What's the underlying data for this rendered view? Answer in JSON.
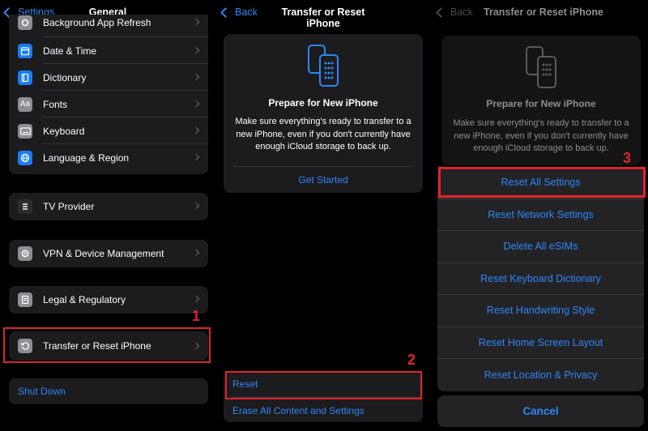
{
  "panel1": {
    "back_label": "Settings",
    "title": "General",
    "group1": [
      {
        "label": "Background App Refresh",
        "icon": "gear-icon",
        "color": "#8e8e93"
      },
      {
        "label": "Date & Time",
        "icon": "calendar-icon",
        "color": "#1a7cf5"
      },
      {
        "label": "Dictionary",
        "icon": "book-icon",
        "color": "#1a7cf5"
      },
      {
        "label": "Fonts",
        "icon": "fonts-icon",
        "color": "#8e8e93"
      },
      {
        "label": "Keyboard",
        "icon": "keyboard-icon",
        "color": "#8e8e93"
      },
      {
        "label": "Language & Region",
        "icon": "globe-icon",
        "color": "#1a7cf5"
      }
    ],
    "tv_provider": "TV Provider",
    "vpn": "VPN & Device Management",
    "legal": "Legal & Regulatory",
    "transfer": "Transfer or Reset iPhone",
    "shutdown": "Shut Down",
    "step": "1"
  },
  "panel2": {
    "back_label": "Back",
    "title": "Transfer or Reset iPhone",
    "card_title": "Prepare for New iPhone",
    "card_desc": "Make sure everything's ready to transfer to a new iPhone, even if you don't currently have enough iCloud storage to back up.",
    "get_started": "Get Started",
    "reset": "Reset",
    "erase": "Erase All Content and Settings",
    "step": "2"
  },
  "panel3": {
    "back_label": "Back",
    "title": "Transfer or Reset iPhone",
    "card_title": "Prepare for New iPhone",
    "card_desc": "Make sure everything's ready to transfer to a new iPhone, even if you don't currently have enough iCloud storage to back up.",
    "options": [
      "Reset All Settings",
      "Reset Network Settings",
      "Delete All eSIMs",
      "Reset Keyboard Dictionary",
      "Reset Handwriting Style",
      "Reset Home Screen Layout",
      "Reset Location & Privacy"
    ],
    "cancel": "Cancel",
    "step": "3"
  },
  "colors": {
    "accent": "#2f86f6",
    "highlight": "#e0232b"
  }
}
